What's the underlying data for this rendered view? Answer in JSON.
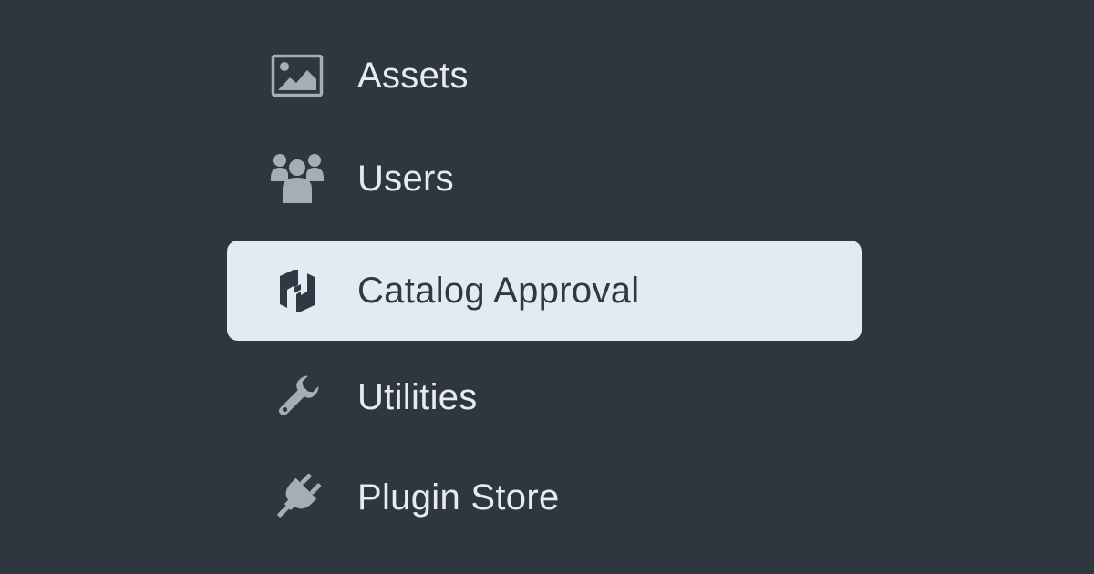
{
  "sidebar": {
    "items": [
      {
        "label": "Assets",
        "icon": "image-icon",
        "active": false
      },
      {
        "label": "Users",
        "icon": "users-icon",
        "active": false
      },
      {
        "label": "Catalog Approval",
        "icon": "hashicorp-logo-icon",
        "active": true
      },
      {
        "label": "Utilities",
        "icon": "wrench-icon",
        "active": false
      },
      {
        "label": "Plugin Store",
        "icon": "plug-icon",
        "active": false
      }
    ]
  },
  "colors": {
    "background": "#2e3640",
    "item_text": "#e8ebee",
    "icon": "#a7adb4",
    "active_background": "#e2eaf4",
    "active_text": "#2f3944"
  }
}
